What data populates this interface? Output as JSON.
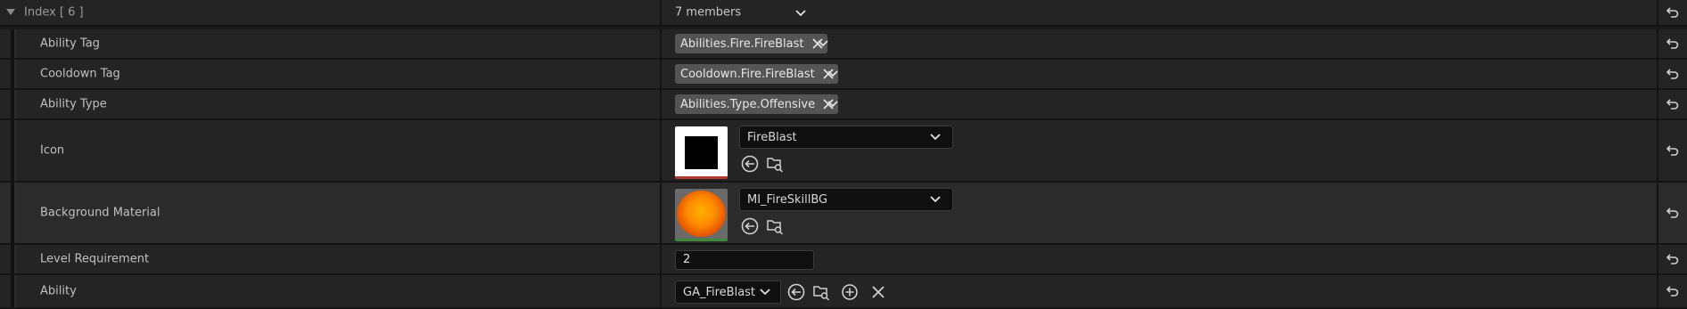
{
  "header": {
    "label": "Index [ 6 ]",
    "members": "7 members"
  },
  "rows": {
    "ability_tag": {
      "label": "Ability Tag",
      "tag": "Abilities.Fire.FireBlast"
    },
    "cooldown_tag": {
      "label": "Cooldown Tag",
      "tag": "Cooldown.Fire.FireBlast"
    },
    "ability_type": {
      "label": "Ability Type",
      "tag": "Abilities.Type.Offensive"
    },
    "icon": {
      "label": "Icon",
      "asset": "FireBlast"
    },
    "background_material": {
      "label": "Background Material",
      "asset": "MI_FireSkillBG"
    },
    "level_requirement": {
      "label": "Level Requirement",
      "value": "2"
    },
    "ability": {
      "label": "Ability",
      "class": "GA_FireBlast"
    }
  },
  "icons": {
    "reset": "reset-arrow-icon",
    "expand": "triangle-down-icon",
    "chevron": "chevron-down-icon",
    "remove": "close-icon",
    "use_selected": "use-selected-icon",
    "browse": "browse-folder-icon",
    "add": "plus-circle-icon"
  },
  "colors": {
    "background": "#242424",
    "alt_background": "#2b2b2b",
    "tag_pill": "#545454",
    "field": "#0f0f0f"
  }
}
